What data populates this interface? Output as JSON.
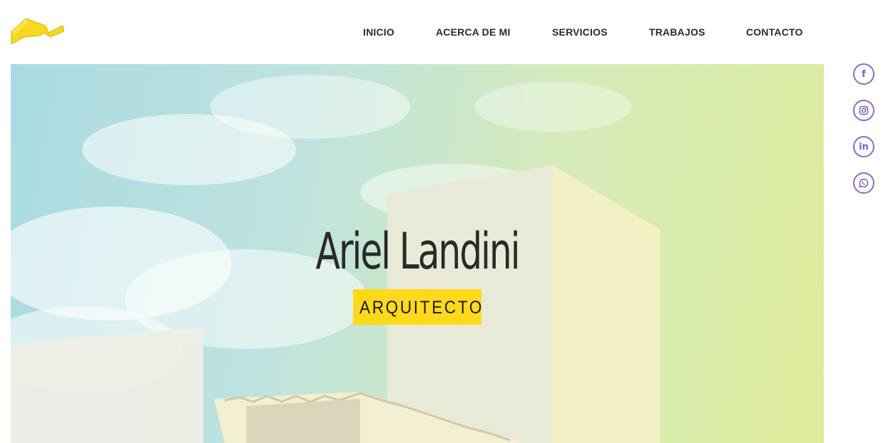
{
  "nav": {
    "items": [
      "INICIO",
      "ACERCA DE MI",
      "SERVICIOS",
      "TRABAJOS",
      "CONTACTO"
    ]
  },
  "hero": {
    "title": "Ariel Landini",
    "subtitle": "ARQUITECTO"
  },
  "social": [
    {
      "icon": "facebook-icon",
      "glyph": "f"
    },
    {
      "icon": "instagram-icon",
      "glyph": ""
    },
    {
      "icon": "linkedin-icon",
      "glyph": "in"
    },
    {
      "icon": "whatsapp-icon",
      "glyph": ""
    }
  ],
  "colors": {
    "accent": "#ffd91a",
    "social": "#8a6bd6",
    "text": "#2b2b2b"
  }
}
